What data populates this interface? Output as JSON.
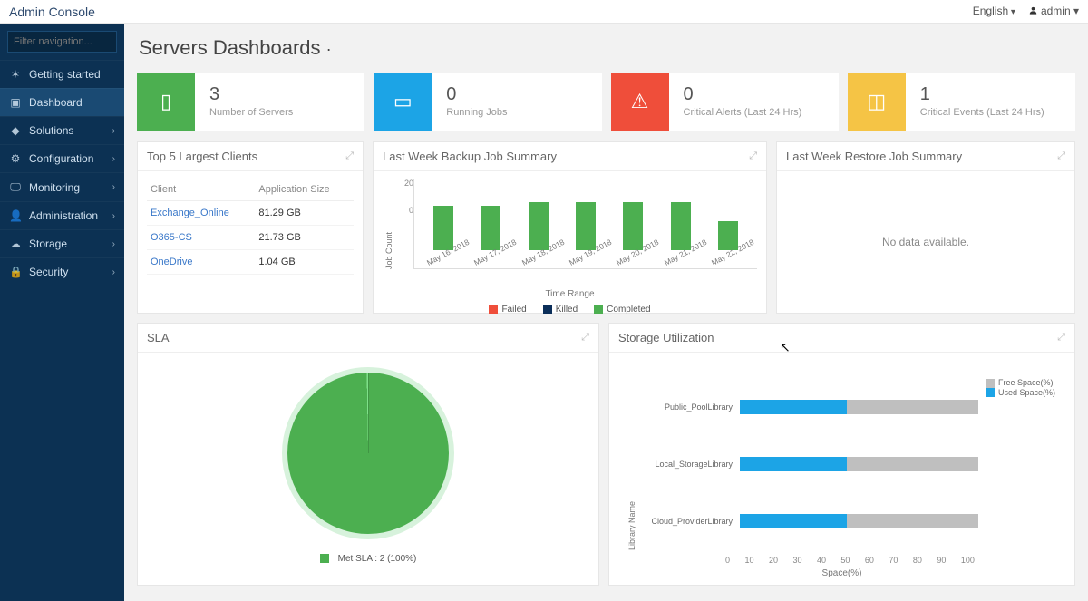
{
  "topbar": {
    "title": "Admin Console",
    "language": "English",
    "user": "admin"
  },
  "sidebar": {
    "filter_placeholder": "Filter navigation...",
    "items": [
      {
        "icon": "✶",
        "label": "Getting started",
        "expandable": false
      },
      {
        "icon": "▣",
        "label": "Dashboard",
        "expandable": false,
        "active": true
      },
      {
        "icon": "◆",
        "label": "Solutions",
        "expandable": true
      },
      {
        "icon": "⚙",
        "label": "Configuration",
        "expandable": true
      },
      {
        "icon": "🖵",
        "label": "Monitoring",
        "expandable": true
      },
      {
        "icon": "👤",
        "label": "Administration",
        "expandable": true
      },
      {
        "icon": "☁",
        "label": "Storage",
        "expandable": true
      },
      {
        "icon": "🔒",
        "label": "Security",
        "expandable": true
      }
    ]
  },
  "page": {
    "title": "Servers Dashboards"
  },
  "stats": [
    {
      "color": "s-green",
      "icon": "server-icon",
      "glyph": "▯",
      "value": "3",
      "label": "Number of Servers"
    },
    {
      "color": "s-blue",
      "icon": "briefcase-icon",
      "glyph": "▭",
      "value": "0",
      "label": "Running Jobs"
    },
    {
      "color": "s-red",
      "icon": "alert-icon",
      "glyph": "⚠",
      "value": "0",
      "label": "Critical Alerts (Last 24 Hrs)"
    },
    {
      "color": "s-yellow",
      "icon": "events-icon",
      "glyph": "◫",
      "value": "1",
      "label": "Critical Events (Last 24 Hrs)"
    }
  ],
  "top5": {
    "title": "Top 5 Largest Clients",
    "cols": [
      "Client",
      "Application Size"
    ],
    "rows": [
      {
        "client": "Exchange_Online",
        "size": "81.29 GB"
      },
      {
        "client": "O365-CS",
        "size": "21.73 GB"
      },
      {
        "client": "OneDrive",
        "size": "1.04 GB"
      }
    ]
  },
  "backup": {
    "title": "Last Week Backup Job Summary",
    "ylabel": "Job Count",
    "xlabel": "Time Range",
    "ymax": 20,
    "legend": [
      "Failed",
      "Killed",
      "Completed"
    ]
  },
  "restore": {
    "title": "Last Week Restore Job Summary",
    "empty_text": "No data available."
  },
  "sla": {
    "title": "SLA",
    "legend": "Met SLA : 2 (100%)"
  },
  "storage": {
    "title": "Storage Utilization",
    "ylabel": "Library Name",
    "xlabel": "Space(%)",
    "legend": [
      "Free Space(%)",
      "Used Space(%)"
    ],
    "ticks": [
      "0",
      "10",
      "20",
      "30",
      "40",
      "50",
      "60",
      "70",
      "80",
      "90",
      "100"
    ]
  },
  "chart_data": [
    {
      "id": "backup_summary",
      "type": "bar",
      "title": "Last Week Backup Job Summary",
      "xlabel": "Time Range",
      "ylabel": "Job Count",
      "ylim": [
        0,
        20
      ],
      "categories": [
        "May 16, 2018",
        "May 17, 2018",
        "May 18, 2018",
        "May 19, 2018",
        "May 20, 2018",
        "May 21, 2018",
        "May 22, 2018"
      ],
      "series": [
        {
          "name": "Failed",
          "values": [
            0,
            0,
            0,
            0,
            0,
            0,
            0
          ]
        },
        {
          "name": "Killed",
          "values": [
            0,
            0,
            0,
            0,
            0,
            0,
            0
          ]
        },
        {
          "name": "Completed",
          "values": [
            14,
            14,
            15,
            15,
            15,
            15,
            9
          ]
        }
      ]
    },
    {
      "id": "sla_pie",
      "type": "pie",
      "title": "SLA",
      "series": [
        {
          "name": "Met SLA",
          "value": 2,
          "pct": 100
        }
      ]
    },
    {
      "id": "storage_utilization",
      "type": "bar",
      "orientation": "horizontal",
      "title": "Storage Utilization",
      "xlabel": "Space(%)",
      "ylabel": "Library Name",
      "xlim": [
        0,
        100
      ],
      "categories": [
        "Public_PoolLibrary",
        "Local_StorageLibrary",
        "Cloud_ProviderLibrary"
      ],
      "series": [
        {
          "name": "Used Space(%)",
          "values": [
            45,
            45,
            45
          ]
        },
        {
          "name": "Free Space(%)",
          "values": [
            55,
            55,
            55
          ]
        }
      ]
    }
  ]
}
